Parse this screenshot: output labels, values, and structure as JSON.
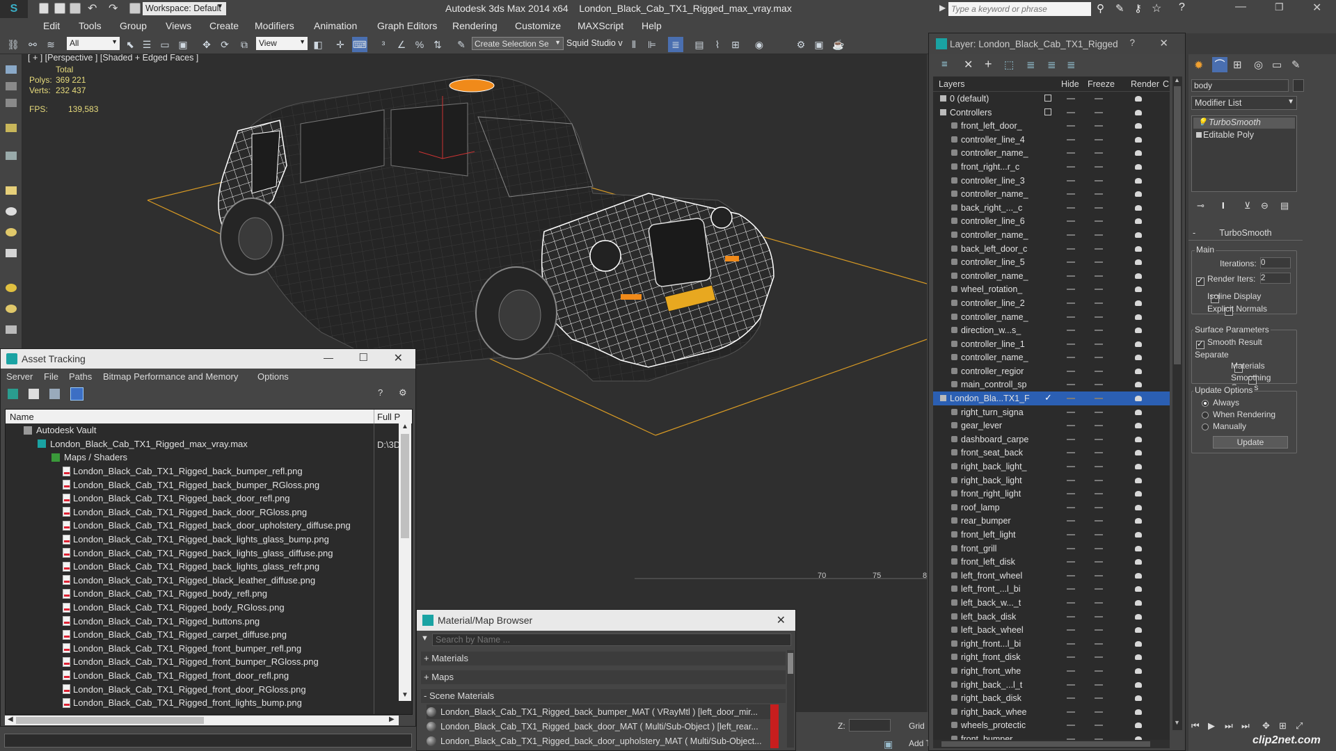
{
  "app": {
    "title": "Autodesk 3ds Max  2014 x64",
    "filename": "London_Black_Cab_TX1_Rigged_max_vray.max",
    "workspace": "Workspace: Default",
    "search_placeholder": "Type a keyword or phrase"
  },
  "menu": [
    "Edit",
    "Tools",
    "Group",
    "Views",
    "Create",
    "Modifiers",
    "Animation",
    "Graph Editors",
    "Rendering",
    "Customize",
    "MAXScript",
    "Help"
  ],
  "toolbar": {
    "filter": "All",
    "view": "View",
    "selection_set": "Create Selection Se",
    "squid": "Squid Studio v"
  },
  "viewport": {
    "label": "[ + ] [Perspective ] [Shaded + Edged Faces ]",
    "total": "Total",
    "polys_label": "Polys:",
    "polys": "369 221",
    "verts_label": "Verts:",
    "verts": "232 437",
    "fps_label": "FPS:",
    "fps": "139,583",
    "timeline_ticks": [
      "70",
      "75",
      "8"
    ],
    "z_label": "Z:",
    "grid_label": "Grid",
    "add_label": "Add T"
  },
  "asset": {
    "title": "Asset Tracking",
    "menu": [
      "Server",
      "File",
      "Paths",
      "Bitmap Performance and Memory",
      "Options"
    ],
    "col_name": "Name",
    "col_path": "Full P",
    "vault": "Autodesk Vault",
    "scene_file": "London_Black_Cab_TX1_Rigged_max_vray.max",
    "scene_path": "D:\\3D",
    "maps_group": "Maps / Shaders",
    "files": [
      "London_Black_Cab_TX1_Rigged_back_bumper_refl.png",
      "London_Black_Cab_TX1_Rigged_back_bumper_RGloss.png",
      "London_Black_Cab_TX1_Rigged_back_door_refl.png",
      "London_Black_Cab_TX1_Rigged_back_door_RGloss.png",
      "London_Black_Cab_TX1_Rigged_back_door_upholstery_diffuse.png",
      "London_Black_Cab_TX1_Rigged_back_lights_glass_bump.png",
      "London_Black_Cab_TX1_Rigged_back_lights_glass_diffuse.png",
      "London_Black_Cab_TX1_Rigged_back_lights_glass_refr.png",
      "London_Black_Cab_TX1_Rigged_black_leather_diffuse.png",
      "London_Black_Cab_TX1_Rigged_body_refl.png",
      "London_Black_Cab_TX1_Rigged_body_RGloss.png",
      "London_Black_Cab_TX1_Rigged_buttons.png",
      "London_Black_Cab_TX1_Rigged_carpet_diffuse.png",
      "London_Black_Cab_TX1_Rigged_front_bumper_refl.png",
      "London_Black_Cab_TX1_Rigged_front_bumper_RGloss.png",
      "London_Black_Cab_TX1_Rigged_front_door_refl.png",
      "London_Black_Cab_TX1_Rigged_front_door_RGloss.png",
      "London_Black_Cab_TX1_Rigged_front_lights_bump.png"
    ]
  },
  "matbrowser": {
    "title": "Material/Map Browser",
    "search_placeholder": "Search by Name ...",
    "materials": "+ Materials",
    "maps": "+ Maps",
    "scene": "- Scene Materials",
    "items": [
      "London_Black_Cab_TX1_Rigged_back_bumper_MAT ( VRayMtl ) [left_door_mir...",
      "London_Black_Cab_TX1_Rigged_back_door_MAT ( Multi/Sub-Object ) [left_rear...",
      "London_Black_Cab_TX1_Rigged_back_door_upholstery_MAT ( Multi/Sub-Object..."
    ]
  },
  "layers": {
    "title": "Layer: London_Black_Cab_TX1_Rigged",
    "help": "?",
    "col_layers": "Layers",
    "col_hide": "Hide",
    "col_freeze": "Freeze",
    "col_render": "Render",
    "col_c": "C",
    "rows": [
      "0 (default)",
      "Controllers",
      "front_left_door_",
      "controller_line_4",
      "controller_name_",
      "front_right...r_c",
      "controller_line_3",
      "controller_name_",
      "back_right_..._c",
      "controller_line_6",
      "controller_name_",
      "back_left_door_c",
      "controller_line_5",
      "controller_name_",
      "wheel_rotation_",
      "controller_line_2",
      "controller_name_",
      "direction_w...s_",
      "controller_line_1",
      "controller_name_",
      "controller_regior",
      "main_controll_sp",
      "London_Bla...TX1_F",
      "right_turn_signa",
      "gear_lever",
      "dashboard_carpe",
      "front_seat_back",
      "right_back_light_",
      "right_back_light",
      "front_right_light",
      "roof_lamp",
      "rear_bumper",
      "front_left_light",
      "front_grill",
      "front_left_disk",
      "left_front_wheel",
      "left_front_...l_bi",
      "left_back_w..._t",
      "left_back_disk",
      "left_back_wheel",
      "right_front...l_bi",
      "right_front_disk",
      "right_front_whe",
      "right_back_...l_t",
      "right_back_disk",
      "right_back_whee",
      "wheels_protectic",
      "front_bumper"
    ]
  },
  "modify": {
    "name_value": "body",
    "modifier_list": "Modifier List",
    "stack": [
      "TurboSmooth",
      "Editable Poly"
    ],
    "rollout": "TurboSmooth",
    "main": "Main",
    "iterations_label": "Iterations:",
    "iterations": "0",
    "render_iters_label": "Render Iters:",
    "render_iters": "2",
    "isoline": "Isoline Display",
    "explicit": "Explicit Normals",
    "surface_params": "Surface Parameters",
    "smooth_result": "Smooth Result",
    "separate": "Separate",
    "materials": "Materials",
    "smoothing_groups": "Smoothing Groups",
    "update_options": "Update Options",
    "always": "Always",
    "when_rendering": "When Rendering",
    "manually": "Manually",
    "update_btn": "Update"
  },
  "watermark": "clip2net.com",
  "colors": {
    "accent_blue": "#2b5fb3",
    "wire": "#ffffff",
    "grid_line": "#d89a24",
    "orange_light": "#f08a1a"
  }
}
